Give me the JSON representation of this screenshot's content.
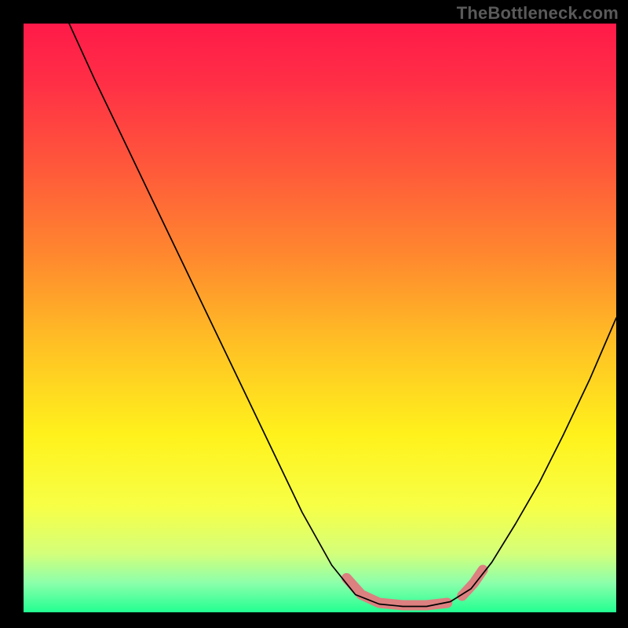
{
  "watermark": "TheBottleneck.com",
  "chart_data": {
    "type": "line",
    "title": "",
    "xlabel": "",
    "ylabel": "",
    "xlim": [
      0,
      1
    ],
    "ylim": [
      0,
      1
    ],
    "grid": false,
    "legend": false,
    "background_gradient_stops": [
      {
        "offset": 0.0,
        "color": "#ff1a49"
      },
      {
        "offset": 0.1,
        "color": "#ff2f46"
      },
      {
        "offset": 0.25,
        "color": "#ff5a3a"
      },
      {
        "offset": 0.4,
        "color": "#ff8a2e"
      },
      {
        "offset": 0.55,
        "color": "#ffc224"
      },
      {
        "offset": 0.7,
        "color": "#fff21c"
      },
      {
        "offset": 0.82,
        "color": "#f7ff46"
      },
      {
        "offset": 0.9,
        "color": "#d4ff7a"
      },
      {
        "offset": 0.95,
        "color": "#8cffab"
      },
      {
        "offset": 1.0,
        "color": "#22ff91"
      }
    ],
    "series": [
      {
        "name": "bottleneck-curve",
        "color": "#000000",
        "points": [
          {
            "x": 0.077,
            "y": 1.0
          },
          {
            "x": 0.12,
            "y": 0.905
          },
          {
            "x": 0.17,
            "y": 0.8
          },
          {
            "x": 0.22,
            "y": 0.695
          },
          {
            "x": 0.27,
            "y": 0.59
          },
          {
            "x": 0.32,
            "y": 0.485
          },
          {
            "x": 0.37,
            "y": 0.38
          },
          {
            "x": 0.42,
            "y": 0.275
          },
          {
            "x": 0.47,
            "y": 0.17
          },
          {
            "x": 0.52,
            "y": 0.08
          },
          {
            "x": 0.56,
            "y": 0.03
          },
          {
            "x": 0.6,
            "y": 0.014
          },
          {
            "x": 0.64,
            "y": 0.01
          },
          {
            "x": 0.68,
            "y": 0.01
          },
          {
            "x": 0.72,
            "y": 0.018
          },
          {
            "x": 0.755,
            "y": 0.04
          },
          {
            "x": 0.79,
            "y": 0.085
          },
          {
            "x": 0.83,
            "y": 0.15
          },
          {
            "x": 0.87,
            "y": 0.22
          },
          {
            "x": 0.91,
            "y": 0.3
          },
          {
            "x": 0.955,
            "y": 0.395
          },
          {
            "x": 1.0,
            "y": 0.5
          }
        ]
      }
    ],
    "highlight": {
      "color": "#dc8080",
      "segments": [
        {
          "points": [
            {
              "x": 0.545,
              "y": 0.058
            },
            {
              "x": 0.57,
              "y": 0.03
            },
            {
              "x": 0.6,
              "y": 0.016
            },
            {
              "x": 0.64,
              "y": 0.012
            },
            {
              "x": 0.68,
              "y": 0.012
            },
            {
              "x": 0.715,
              "y": 0.016
            }
          ]
        },
        {
          "points": [
            {
              "x": 0.74,
              "y": 0.028
            },
            {
              "x": 0.76,
              "y": 0.05
            },
            {
              "x": 0.775,
              "y": 0.072
            }
          ]
        }
      ]
    }
  }
}
